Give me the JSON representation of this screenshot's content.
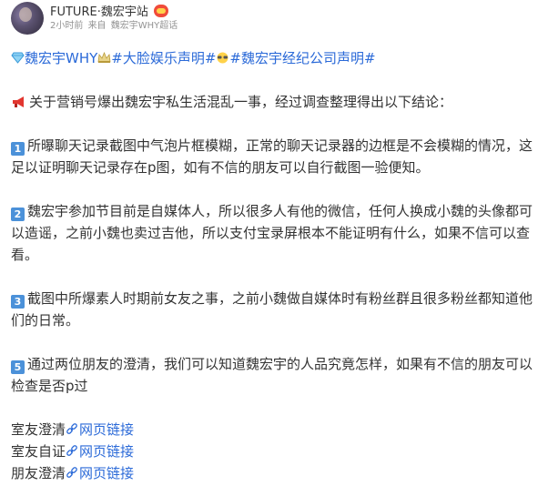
{
  "header": {
    "username": "FUTURE·魏宏宇站",
    "time": "2小时前",
    "source_prefix": "来自",
    "source": "魏宏宇WHY超话"
  },
  "tags": [
    {
      "text": "魏宏宇WHY",
      "icon": "diamond-icon"
    },
    {
      "text": "#大脸娱乐声明#",
      "icon": "crown-icon"
    },
    {
      "text": "#魏宏宇经纪公司声明#",
      "icon": "sunglasses-icon"
    }
  ],
  "tag_1_suffix": "",
  "intro": "关于营销号爆出魏宏宇私生活混乱一事，经过调查整理得出以下结论：",
  "points": [
    {
      "num": "1",
      "text": "所曝聊天记录截图中气泡片框模糊，正常的聊天记录器的边框是不会模糊的情况，这足以证明聊天记录存在p图，如有不信的朋友可以自行截图一验便知。"
    },
    {
      "num": "2",
      "text": "魏宏宇参加节目前是自媒体人，所以很多人有他的微信，任何人换成小魏的头像都可以造谣，之前小魏也卖过吉他，所以支付宝录屏根本不能证明有什么，如果不信可以查看。"
    },
    {
      "num": "3",
      "text": "截图中所爆素人时期前女友之事，之前小魏做自媒体时有粉丝群且很多粉丝都知道他们的日常。"
    },
    {
      "num": "5",
      "text": "通过两位朋友的澄清，我们可以知道魏宏宇的人品究竟怎样，如果有不信的朋友可以检查是否p过"
    }
  ],
  "links": [
    {
      "label": "室友澄清",
      "link_text": "网页链接"
    },
    {
      "label": "室友自证",
      "link_text": "网页链接"
    },
    {
      "label": "朋友澄清",
      "link_text": "网页链接"
    }
  ],
  "colors": {
    "link": "#2b6ad8",
    "text": "#333333",
    "meta": "#939393",
    "number_badge": "#4b91d9"
  }
}
